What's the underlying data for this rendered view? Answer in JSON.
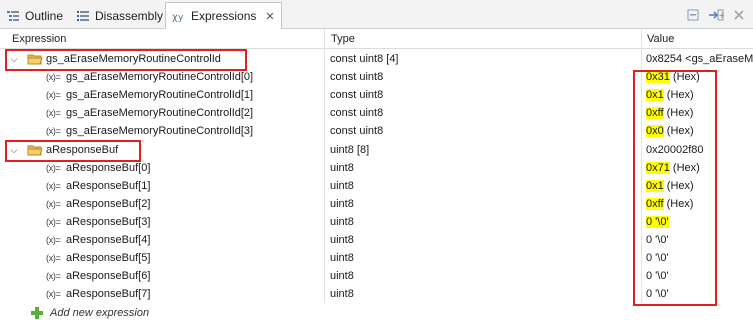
{
  "tabs": [
    {
      "label": "Outline",
      "icon": "outline-icon",
      "active": false
    },
    {
      "label": "Disassembly",
      "icon": "disassembly-icon",
      "active": false
    },
    {
      "label": "Expressions",
      "icon": "expressions-icon",
      "active": true
    }
  ],
  "toolbar": [
    "collapse-all-icon",
    "add-expression-icon",
    "remove-icon"
  ],
  "columns": {
    "expression": "Expression",
    "type": "Type",
    "value": "Value"
  },
  "rows": [
    {
      "expr": "gs_aEraseMemoryRoutineControlId",
      "type": "const uint8 [4]",
      "value": "0x8254 <gs_aEraseM"
    },
    {
      "expr": "gs_aEraseMemoryRoutineControlId[0]",
      "type": "const uint8",
      "value_main": "0x31",
      "value_suffix": " (Hex)"
    },
    {
      "expr": "gs_aEraseMemoryRoutineControlId[1]",
      "type": "const uint8",
      "value_main": "0x1",
      "value_suffix": " (Hex)"
    },
    {
      "expr": "gs_aEraseMemoryRoutineControlId[2]",
      "type": "const uint8",
      "value_main": "0xff",
      "value_suffix": " (Hex)"
    },
    {
      "expr": "gs_aEraseMemoryRoutineControlId[3]",
      "type": "const uint8",
      "value_main": "0x0",
      "value_suffix": " (Hex)"
    },
    {
      "expr": "aResponseBuf",
      "type": "uint8 [8]",
      "value": "0x20002f80"
    },
    {
      "expr": "aResponseBuf[0]",
      "type": "uint8",
      "value_main": "0x71",
      "value_suffix": " (Hex)"
    },
    {
      "expr": "aResponseBuf[1]",
      "type": "uint8",
      "value_main": "0x1",
      "value_suffix": " (Hex)"
    },
    {
      "expr": "aResponseBuf[2]",
      "type": "uint8",
      "value_main": "0xff",
      "value_suffix": " (Hex)"
    },
    {
      "expr": "aResponseBuf[3]",
      "type": "uint8",
      "value_main": "0 '\\0'",
      "value_suffix": ""
    },
    {
      "expr": "aResponseBuf[4]",
      "type": "uint8",
      "value": "0 '\\0'"
    },
    {
      "expr": "aResponseBuf[5]",
      "type": "uint8",
      "value": "0 '\\0'"
    },
    {
      "expr": "aResponseBuf[6]",
      "type": "uint8",
      "value": "0 '\\0'"
    },
    {
      "expr": "aResponseBuf[7]",
      "type": "uint8",
      "value": "0 '\\0'"
    }
  ],
  "add_expression": "Add new expression",
  "child_prefix": "(x)=",
  "colors": {
    "highlight": "#ffff00",
    "annotation": "#e02020"
  }
}
